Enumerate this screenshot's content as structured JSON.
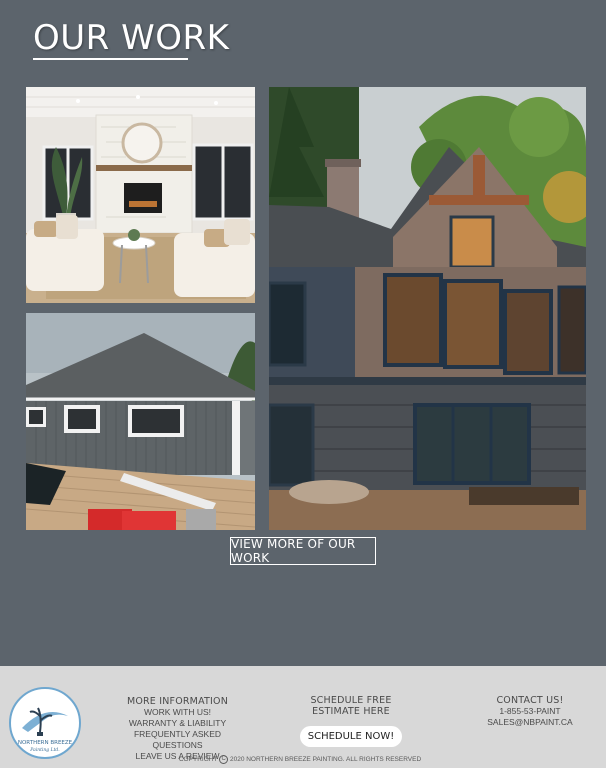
{
  "section": {
    "title": "OUR WORK"
  },
  "gallery": {
    "view_more_label": "VIEW MORE OF OUR WORK",
    "photos": [
      "living-room-photo",
      "boathouse-photo",
      "house-exterior-photo"
    ]
  },
  "footer": {
    "logo_text": "NORTHERN BREEZE",
    "logo_subtext": "Painting Ltd.",
    "info": {
      "heading": "MORE INFORMATION",
      "items": [
        "WORK WITH US!",
        "WARRANTY & LIABILITY",
        "FREQUENTLY ASKED QUESTIONS",
        "LEAVE US A REVIEW"
      ]
    },
    "schedule": {
      "heading": "SCHEDULE FREE ESTIMATE HERE",
      "button_label": "SCHEDULE NOW!"
    },
    "contact": {
      "heading": "CONTACT US!",
      "phone": "1-855-53-PAINT",
      "email": "SALES@NBPAINT.CA"
    },
    "copyright_pre": "COPYRIGHT",
    "copyright_symbol": "C",
    "copyright_post": "2020 NORTHERN BREEZE PAINTING. ALL RIGHTS RESERVED"
  }
}
